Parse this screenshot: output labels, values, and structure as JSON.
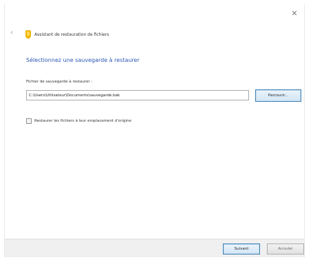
{
  "window": {
    "close_glyph": "✕",
    "back_glyph": "‹"
  },
  "header": {
    "title": "Assistant de restauration de fichiers",
    "icon": "wizard-shield-icon",
    "icon_color": "#f0b400"
  },
  "instruction": "Sélectionnez une sauvegarde à restaurer",
  "file_field": {
    "label": "Fichier de sauvegarde à restaurer :",
    "value": "C:\\Users\\Utilisateur\\Documents\\sauvegarde.bak",
    "placeholder": ""
  },
  "browse_button": "Parcourir...",
  "checkbox": {
    "label": "Restaurer les fichiers à leur emplacement d'origine",
    "checked": false
  },
  "footer": {
    "next_label": "Suivant",
    "cancel_label": "Annuler"
  },
  "colors": {
    "accent_link": "#2b58b7",
    "button_border": "#3c7fb1"
  }
}
